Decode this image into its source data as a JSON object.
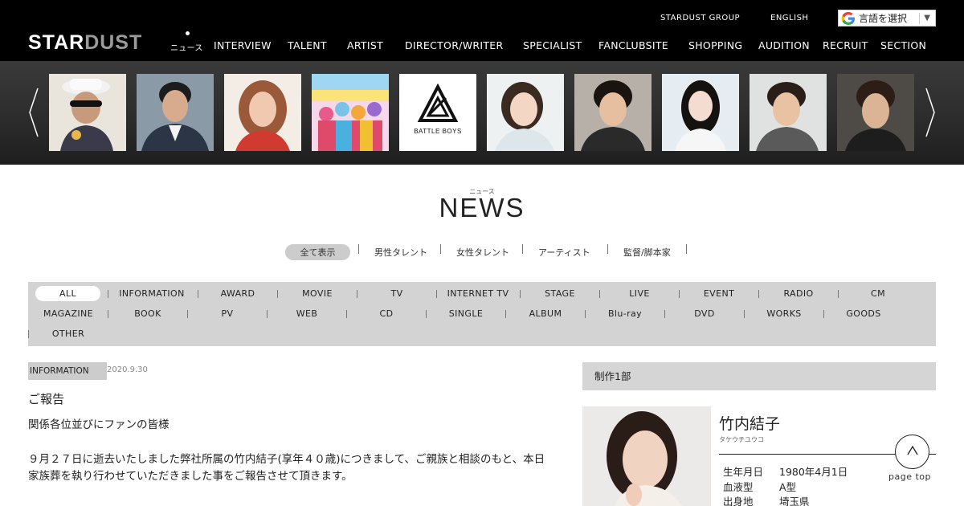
{
  "header": {
    "logo_main": "STAR",
    "logo_accent": "DUST",
    "logo_sub": "ニュース",
    "top_links": [
      "STARDUST GROUP",
      "ENGLISH"
    ],
    "language_select": "言語を選択",
    "nav": [
      "INTERVIEW",
      "TALENT",
      "ARTIST",
      "DIRECTOR/WRITER",
      "SPECIALIST",
      "FANCLUBSITE",
      "SHOPPING",
      "AUDITION",
      "RECRUIT",
      "SECTION"
    ]
  },
  "carousel": {
    "items": [
      {
        "name": "talent-1",
        "caption": ""
      },
      {
        "name": "talent-2",
        "caption": ""
      },
      {
        "name": "talent-3",
        "caption": ""
      },
      {
        "name": "talent-4",
        "caption": ""
      },
      {
        "name": "battle-boys",
        "caption": "BATTLE BOYS"
      },
      {
        "name": "talent-6",
        "caption": ""
      },
      {
        "name": "talent-7",
        "caption": ""
      },
      {
        "name": "talent-8",
        "caption": ""
      },
      {
        "name": "talent-9",
        "caption": ""
      },
      {
        "name": "talent-10",
        "caption": ""
      }
    ]
  },
  "news": {
    "kana": "ニュース",
    "title": "NEWS",
    "filters": [
      "全て表示",
      "男性タレント",
      "女性タレント",
      "アーティスト",
      "監督/脚本家"
    ],
    "categories": [
      "ALL",
      "INFORMATION",
      "AWARD",
      "MOVIE",
      "TV",
      "INTERNET TV",
      "STAGE",
      "LIVE",
      "EVENT",
      "RADIO",
      "CM",
      "MAGAZINE",
      "BOOK",
      "PV",
      "WEB",
      "CD",
      "SINGLE",
      "ALBUM",
      "Blu-ray",
      "DVD",
      "WORKS",
      "GOODS",
      "OTHER"
    ]
  },
  "article": {
    "tag": "INFORMATION",
    "date": "2020.9.30",
    "title": "ご報告",
    "paragraphs": [
      "関係各位並びにファンの皆様",
      "９月２７日に逝去いたしました弊社所属の竹内結子(享年４０歳)につきまして、ご親族と相談のもと、本日",
      "家族葬を執り行わせていただきました事をご報告させて頂きます。"
    ]
  },
  "sidebar": {
    "section": "制作1部",
    "name": "竹内結子",
    "kana": "タケウチユウコ",
    "profile": [
      {
        "label": "生年月日",
        "value": "1980年4月1日"
      },
      {
        "label": "血液型",
        "value": "A型"
      },
      {
        "label": "出身地",
        "value": "埼玉県"
      }
    ]
  },
  "page_top_label": "page top",
  "colors": {
    "header_bg": "#000000",
    "category_bar": "#d3d3d3",
    "active_pill": "#cccccc"
  }
}
